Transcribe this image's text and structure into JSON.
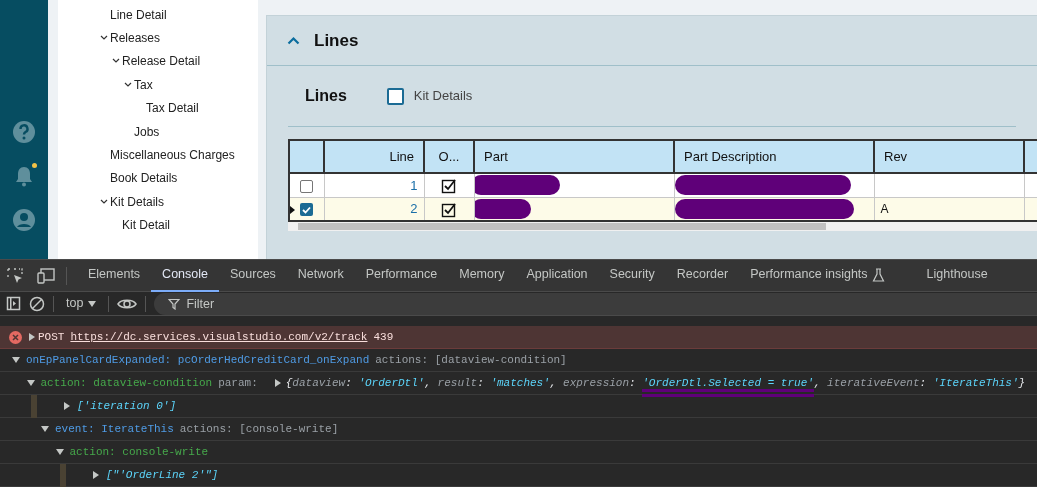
{
  "rail": {
    "items": [
      {
        "kind": "help",
        "badge": false
      },
      {
        "kind": "notifications",
        "badge": true
      },
      {
        "kind": "account",
        "badge": false
      }
    ]
  },
  "tree": [
    {
      "label": "Line Detail"
    },
    {
      "label": "Releases",
      "expanded": true,
      "children": [
        {
          "label": "Release Detail",
          "expanded": true,
          "children": [
            {
              "label": "Tax",
              "expanded": true,
              "children": [
                {
                  "label": "Tax Detail"
                }
              ]
            },
            {
              "label": "Jobs"
            }
          ]
        }
      ]
    },
    {
      "label": "Miscellaneous Charges"
    },
    {
      "label": "Book Details"
    },
    {
      "label": "Kit Details",
      "expanded": true,
      "children": [
        {
          "label": "Kit Detail"
        }
      ]
    }
  ],
  "panel": {
    "title": "Lines",
    "expanded": true,
    "section_title": "Lines",
    "kit_details": {
      "label": "Kit Details",
      "checked": false
    }
  },
  "table": {
    "columns": [
      {
        "kind": "select"
      },
      {
        "kind": "number",
        "label": "Line"
      },
      {
        "kind": "check",
        "label": "O..."
      },
      {
        "kind": "text",
        "label": "Part"
      },
      {
        "kind": "text",
        "label": "Part Description"
      },
      {
        "kind": "text",
        "label": "Rev"
      },
      {
        "kind": "text"
      }
    ],
    "rows": [
      {
        "selected": false,
        "current": false,
        "line": "1",
        "o_checked": true,
        "part_redacted": true,
        "description_redacted": true
      },
      {
        "selected": true,
        "current": true,
        "line": "2",
        "o_checked": true,
        "part_redacted": true,
        "description_redacted": true,
        "rev": "A"
      }
    ]
  },
  "devtools": {
    "tabs": [
      {
        "label": "Elements",
        "selected": false
      },
      {
        "label": "Console",
        "selected": true
      },
      {
        "label": "Sources",
        "selected": false
      },
      {
        "label": "Network",
        "selected": false
      },
      {
        "label": "Performance",
        "selected": false
      },
      {
        "label": "Memory",
        "selected": false
      },
      {
        "label": "Application",
        "selected": false
      },
      {
        "label": "Security",
        "selected": false
      },
      {
        "label": "Recorder",
        "selected": false
      },
      {
        "label": "Performance insights",
        "selected": false,
        "experimental": true
      },
      {
        "label": "Lighthouse",
        "selected": false
      }
    ],
    "context": "top",
    "filter": {
      "placeholder": "Filter"
    },
    "console": [
      {
        "kind": "error",
        "expanded": false,
        "method": "POST",
        "url": "https://dc.services.visualstudio.com/v2/track",
        "status": "439"
      },
      {
        "kind": "group",
        "expanded": true,
        "segments": [
          {
            "text": "onEpPanelCardExpanded: pcOrderHedCreditCard_onExpand",
            "kind": "event"
          },
          {
            "text": "actions: [dataview-condition]",
            "kind": "muted"
          }
        ],
        "children": [
          {
            "kind": "group",
            "expanded": true,
            "segments": [
              {
                "text": "action: dataview-condition",
                "kind": "action"
              },
              {
                "text": "param:",
                "kind": "muted"
              }
            ],
            "object": {
              "expanded": false,
              "segments": [
                {
                  "text": "{",
                  "kind": "punct"
                },
                {
                  "text": "dataview",
                  "kind": "prop"
                },
                {
                  "text": ": ",
                  "kind": "punct"
                },
                {
                  "text": "'OrderDtl'",
                  "kind": "string"
                },
                {
                  "text": ", ",
                  "kind": "punct"
                },
                {
                  "text": "result",
                  "kind": "prop"
                },
                {
                  "text": ": ",
                  "kind": "punct"
                },
                {
                  "text": "'matches'",
                  "kind": "string"
                },
                {
                  "text": ", ",
                  "kind": "punct"
                },
                {
                  "text": "expression",
                  "kind": "prop"
                },
                {
                  "text": ": ",
                  "kind": "punct"
                },
                {
                  "text": "'OrderDtl.Selected = true'",
                  "kind": "string",
                  "marked": true
                },
                {
                  "text": ", ",
                  "kind": "punct"
                },
                {
                  "text": "iterativeEvent",
                  "kind": "prop"
                },
                {
                  "text": ": ",
                  "kind": "punct"
                },
                {
                  "text": "'IterateThis'",
                  "kind": "string"
                },
                {
                  "text": "}",
                  "kind": "punct"
                }
              ]
            },
            "children": [
              {
                "kind": "message",
                "expanded": false,
                "segments": [
                  {
                    "text": "['iteration 0']",
                    "kind": "string"
                  }
                ]
              },
              {
                "kind": "group",
                "expanded": true,
                "segments": [
                  {
                    "text": "event: IterateThis",
                    "kind": "event"
                  },
                  {
                    "text": "actions: [console-write]",
                    "kind": "muted"
                  }
                ],
                "children": [
                  {
                    "kind": "group",
                    "expanded": true,
                    "segments": [
                      {
                        "text": "action: console-write",
                        "kind": "action"
                      }
                    ],
                    "children": [
                      {
                        "kind": "message",
                        "expanded": false,
                        "segments": [
                          {
                            "text": "[\"'OrderLine 2'\"]",
                            "kind": "string"
                          }
                        ]
                      }
                    ]
                  }
                ]
              }
            ]
          }
        ]
      }
    ]
  }
}
